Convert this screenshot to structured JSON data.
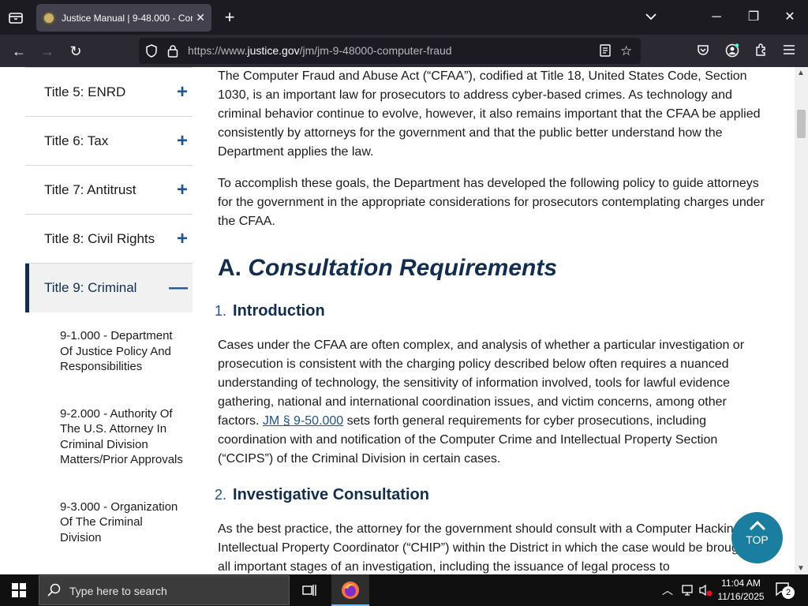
{
  "browser": {
    "tab_title": "Justice Manual | 9-48.000 - Com",
    "url_prefix": "https://www.",
    "url_domain": "justice.gov",
    "url_path": "/jm/jm-9-48000-computer-fraud"
  },
  "sidebar": {
    "items": [
      {
        "label": "Title 5: ENRD",
        "toggle": "+"
      },
      {
        "label": "Title 6: Tax",
        "toggle": "+"
      },
      {
        "label": "Title 7: Antitrust",
        "toggle": "+"
      },
      {
        "label": "Title 8: Civil Rights",
        "toggle": "+"
      },
      {
        "label": "Title 9: Criminal",
        "toggle": "—"
      }
    ],
    "subitems": [
      {
        "label": "9-1.000 - Department Of Justice Policy And Responsibilities"
      },
      {
        "label": "9-2.000 - Authority Of The U.S. Attorney In Criminal Division Matters/Prior Approvals"
      },
      {
        "label": "9-3.000 - Organization Of The Criminal Division"
      }
    ]
  },
  "content": {
    "p1": "The Computer Fraud and Abuse Act (“CFAA”), codified at Title 18, United States Code, Section 1030, is an important law for prosecutors to address cyber-based crimes. As technology and criminal behavior continue to evolve, however, it also remains important that the CFAA be applied consistently by attorneys for the government and that the public better understand how the Department applies the law.",
    "p2": "To accomplish these goals, the Department has developed the following policy to guide attorneys for the government in the appropriate considerations for prosecutors contemplating charges under the CFAA.",
    "h2_letter": "A.",
    "h2_title": "Consultation Requirements",
    "s1_num": "1.",
    "s1_title": "Introduction",
    "p3_before": "Cases under the CFAA are often complex, and analysis of whether a particular investigation or prosecution is consistent with the charging policy described below often requires a nuanced understanding of technology, the sensitivity of information involved, tools for lawful evidence gathering, national and international coordination issues, and victim concerns, among other factors.",
    "p3_link": "JM § 9-50.000",
    "p3_after": "sets forth general requirements for cyber prosecutions, including coordination with and notification of the Computer Crime and Intellectual Property Section (“CCIPS”) of the Criminal Division in certain cases.",
    "s2_num": "2.",
    "s2_title": "Investigative Consultation",
    "p4": "As the best practice, the attorney for the government should consult with a Computer Hacking and Intellectual Property Coordinator (“CHIP”) within the District in which the case would be brought at all important stages of an investigation, including the issuance of legal process to",
    "top_label": "TOP"
  },
  "taskbar": {
    "search_placeholder": "Type here to search",
    "time": "11:04 AM",
    "date": "11/16/2025",
    "notification_count": "2"
  }
}
